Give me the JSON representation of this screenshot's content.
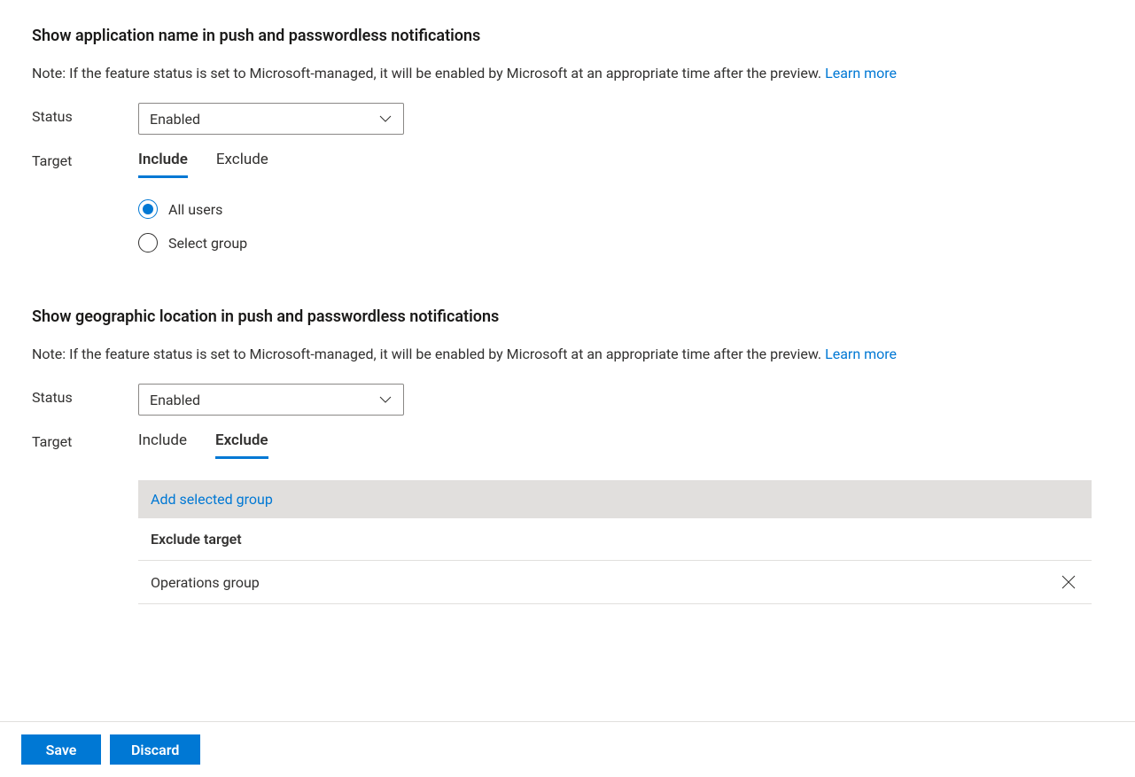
{
  "section1": {
    "heading": "Show application name in push and passwordless notifications",
    "note": "Note: If the feature status is set to Microsoft-managed, it will be enabled by Microsoft at an appropriate time after the preview. ",
    "learn_more": "Learn more",
    "status_label": "Status",
    "status_value": "Enabled",
    "target_label": "Target",
    "tabs": {
      "include": "Include",
      "exclude": "Exclude"
    },
    "radios": {
      "all_users": "All users",
      "select_group": "Select group"
    }
  },
  "section2": {
    "heading": "Show geographic location in push and passwordless notifications",
    "note": "Note: If the feature status is set to Microsoft-managed, it will be enabled by Microsoft at an appropriate time after the preview. ",
    "learn_more": "Learn more",
    "status_label": "Status",
    "status_value": "Enabled",
    "target_label": "Target",
    "tabs": {
      "include": "Include",
      "exclude": "Exclude"
    },
    "add_selected": "Add selected group",
    "exclude_header": "Exclude target",
    "exclude_items": [
      "Operations group"
    ]
  },
  "footer": {
    "save": "Save",
    "discard": "Discard"
  }
}
